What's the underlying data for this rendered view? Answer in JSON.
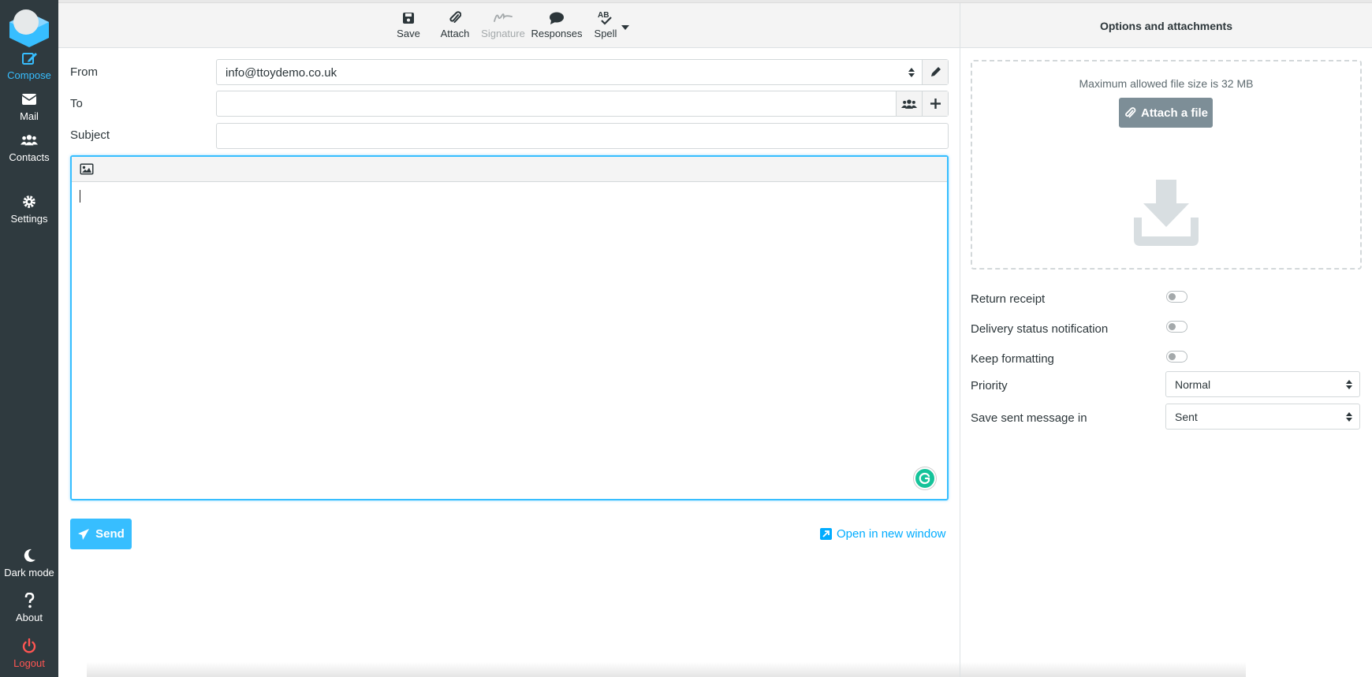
{
  "nav": {
    "items": [
      {
        "label": "Compose",
        "icon": "compose-icon"
      },
      {
        "label": "Mail",
        "icon": "envelope-icon"
      },
      {
        "label": "Contacts",
        "icon": "users-icon"
      },
      {
        "label": "Settings",
        "icon": "gear-icon"
      }
    ],
    "bottom": [
      {
        "label": "Dark mode",
        "icon": "moon-icon"
      },
      {
        "label": "About",
        "icon": "question-icon"
      },
      {
        "label": "Logout",
        "icon": "power-icon"
      }
    ]
  },
  "toolbar": {
    "save": "Save",
    "attach": "Attach",
    "signature": "Signature",
    "responses": "Responses",
    "spell": "Spell"
  },
  "compose": {
    "from_label": "From",
    "from_value": "info@ttoydemo.co.uk",
    "to_label": "To",
    "to_value": "",
    "subject_label": "Subject",
    "subject_value": "",
    "body": "",
    "send_label": "Send",
    "open_new_window": "Open in new window"
  },
  "panel": {
    "title": "Options and attachments",
    "max_size_text": "Maximum allowed file size is 32 MB",
    "attach_file": "Attach a file",
    "options": [
      {
        "label": "Return receipt",
        "enabled": false
      },
      {
        "label": "Delivery status notification",
        "enabled": false
      },
      {
        "label": "Keep formatting",
        "enabled": false
      }
    ],
    "priority_label": "Priority",
    "priority_value": "Normal",
    "save_sent_label": "Save sent message in",
    "save_sent_value": "Sent"
  },
  "colors": {
    "accent": "#37beff",
    "nav_bg": "#2f3a3f",
    "logout": "#ff5552"
  }
}
